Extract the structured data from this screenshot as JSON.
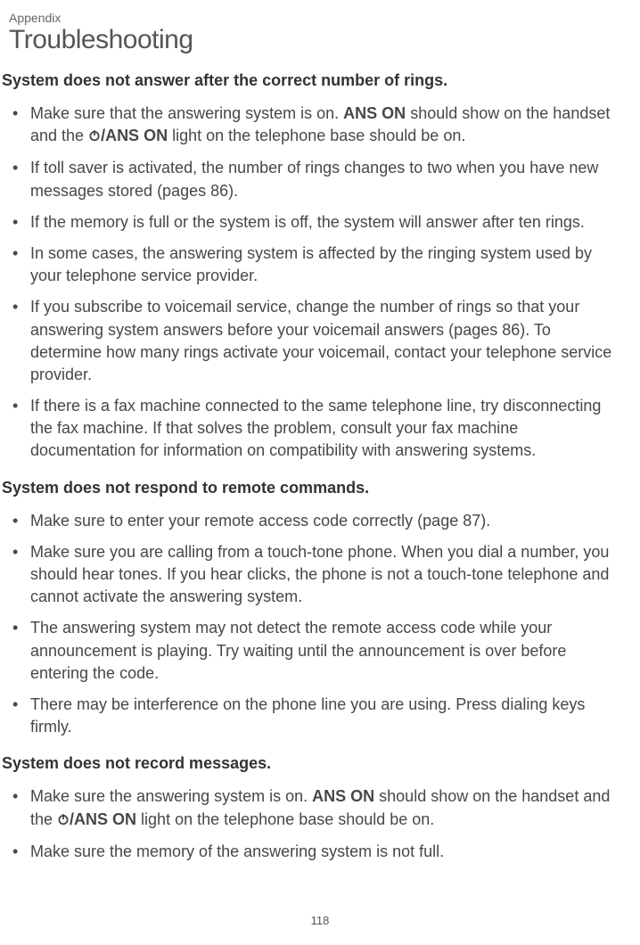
{
  "eyebrow": "Appendix",
  "title": "Troubleshooting",
  "page_number": "118",
  "sections": [
    {
      "heading": "System does not answer after the correct number of rings.",
      "items": [
        {
          "type": "ans_on",
          "pre": "Make sure that the answering system is on. ",
          "bold1": "ANS ON",
          "mid": " should show on the handset and the ",
          "bold2": "/ANS ON",
          "post": " light on the telephone base should be on."
        },
        {
          "type": "plain",
          "text": "If toll saver is activated, the number of rings changes to two when you have new messages stored (pages 86)."
        },
        {
          "type": "plain",
          "text": "If the memory is full or the system is off, the system will answer after ten rings."
        },
        {
          "type": "plain",
          "text": "In some cases, the answering system is affected by the ringing system used by your telephone service provider."
        },
        {
          "type": "plain",
          "text": "If you subscribe to voicemail service, change the number of rings so that your answering system answers before your voicemail answers (pages 86). To determine how many rings activate your voicemail, contact your telephone service provider."
        },
        {
          "type": "plain",
          "text": "If there is a fax machine connected to the same telephone line, try disconnecting the fax machine. If that solves the problem, consult your fax machine documentation for information on compatibility with answering systems."
        }
      ]
    },
    {
      "heading": "System does not respond to remote commands.",
      "items": [
        {
          "type": "plain",
          "text": "Make sure to enter your remote access code correctly (page 87)."
        },
        {
          "type": "plain",
          "text": "Make sure you are calling from a touch-tone phone. When you dial a number, you should hear tones. If you hear clicks, the phone is not a touch-tone telephone and cannot activate the answering system."
        },
        {
          "type": "plain",
          "text": "The answering system may not detect the remote access code while your announcement is playing. Try waiting until the announcement is over before entering the code."
        },
        {
          "type": "plain",
          "text": "There may be interference on the phone line you are using. Press dialing keys firmly."
        }
      ]
    },
    {
      "heading": "System does not record messages.",
      "items": [
        {
          "type": "ans_on",
          "pre": "Make sure the answering system is on. ",
          "bold1": "ANS ON",
          "mid": " should show on the handset and the ",
          "bold2": "/ANS ON",
          "post": " light on the telephone base should be on."
        },
        {
          "type": "plain",
          "text": "Make sure the memory of the answering system is not full."
        }
      ]
    }
  ]
}
